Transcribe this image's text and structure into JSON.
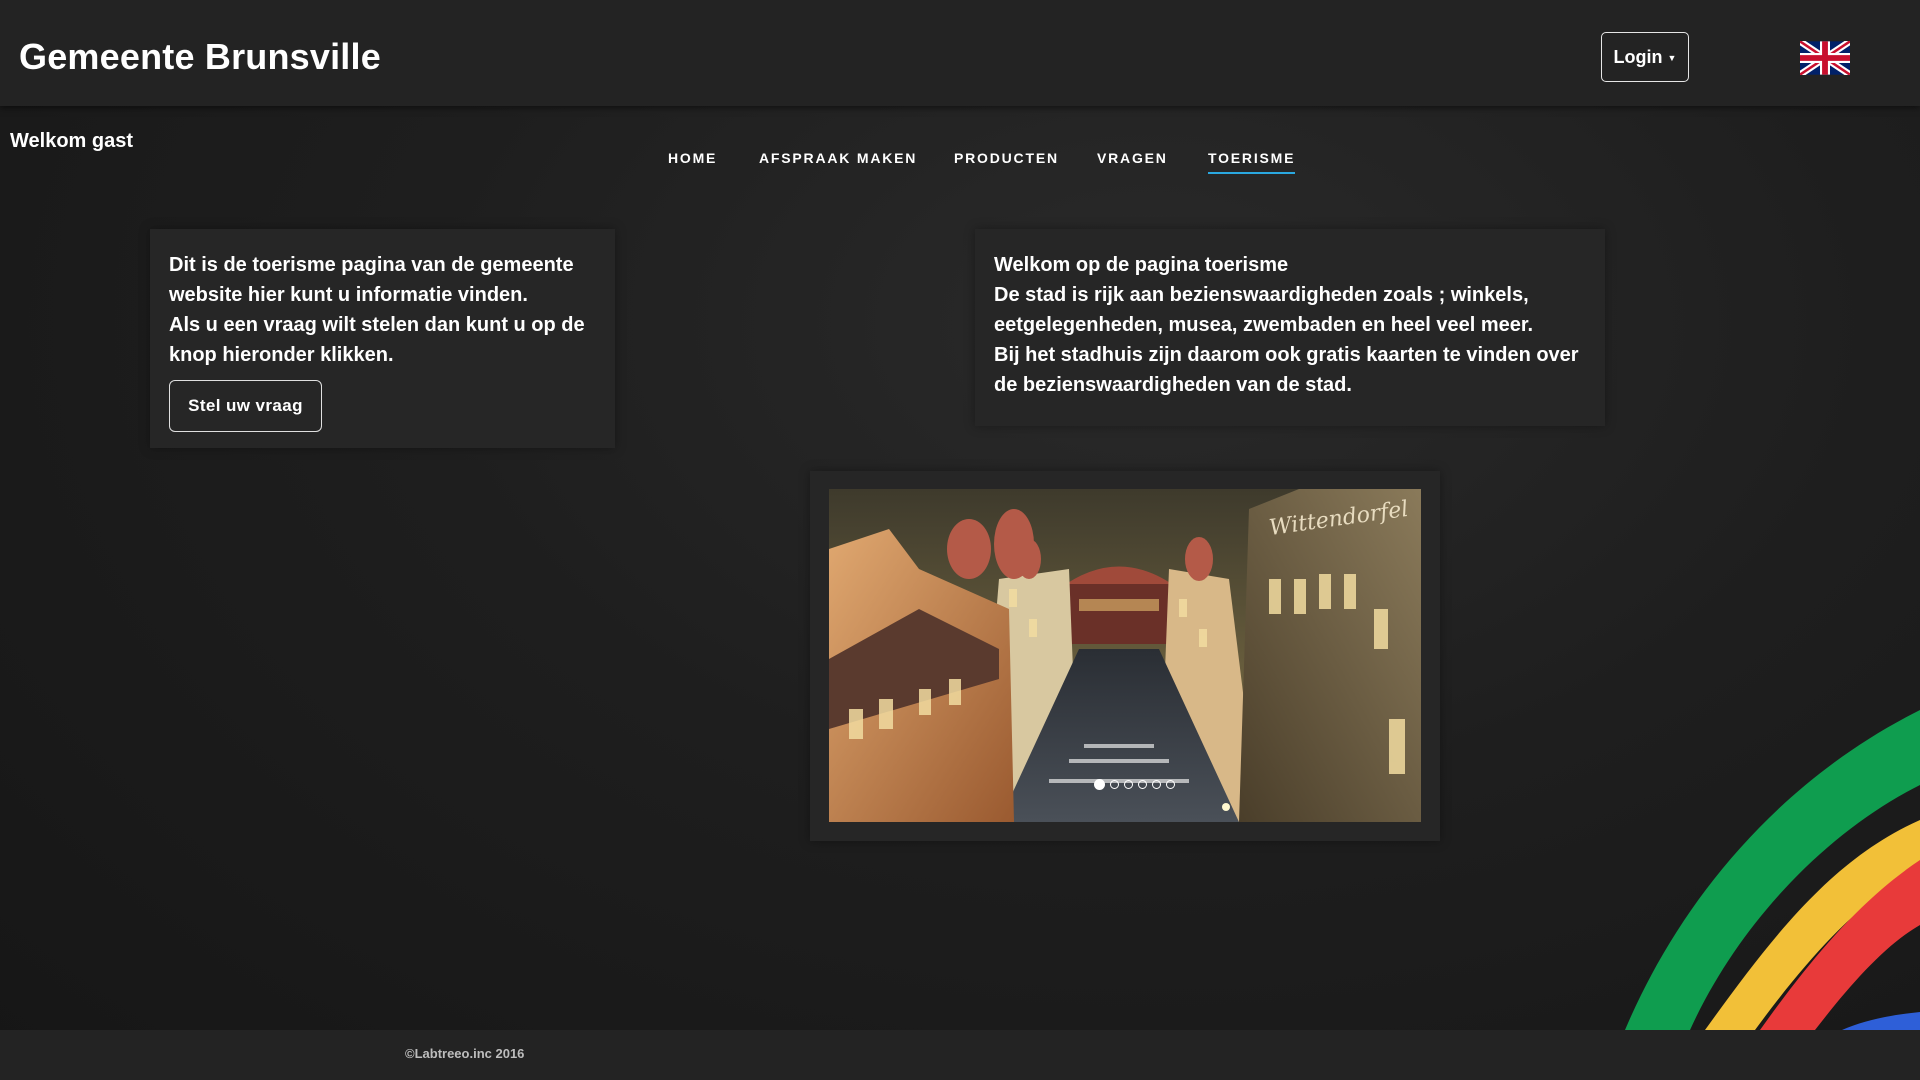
{
  "header": {
    "title": "Gemeente Brunsville",
    "login_label": "Login"
  },
  "welcome_text": "Welkom gast",
  "nav": {
    "items": [
      {
        "label": "HOME"
      },
      {
        "label": "AFSPRAAK MAKEN"
      },
      {
        "label": "PRODUCTEN"
      },
      {
        "label": "VRAGEN"
      },
      {
        "label": "TOERISME"
      }
    ],
    "active": "TOERISME"
  },
  "left_card": {
    "lines": [
      "Dit is de toerisme pagina van de gemeente",
      "website hier kunt u informatie vinden.",
      "Als u een vraag wilt stelen dan kunt u op de",
      "knop hieronder klikken."
    ],
    "button_label": "Stel uw vraag"
  },
  "right_card": {
    "lines": [
      "Welkom op de pagina toerisme",
      "De stad is rijk aan bezienswaardigheden zoals ; winkels,",
      "eetgelegenheden, musea, zwembaden en heel veel meer.",
      "Bij het stadhuis zijn daarom ook gratis kaarten te vinden over",
      "de bezienswaardigheden van de stad."
    ]
  },
  "carousel": {
    "slide_count": 6,
    "active_index": 0,
    "sign_text": "Wittendorfel"
  },
  "footer": {
    "copyright": "©Labtreeo.inc 2016"
  },
  "colors": {
    "accent": "#2aa8e0",
    "background": "#1e1e1e",
    "bar": "#232323"
  },
  "icons": {
    "language": "uk-flag-icon"
  }
}
